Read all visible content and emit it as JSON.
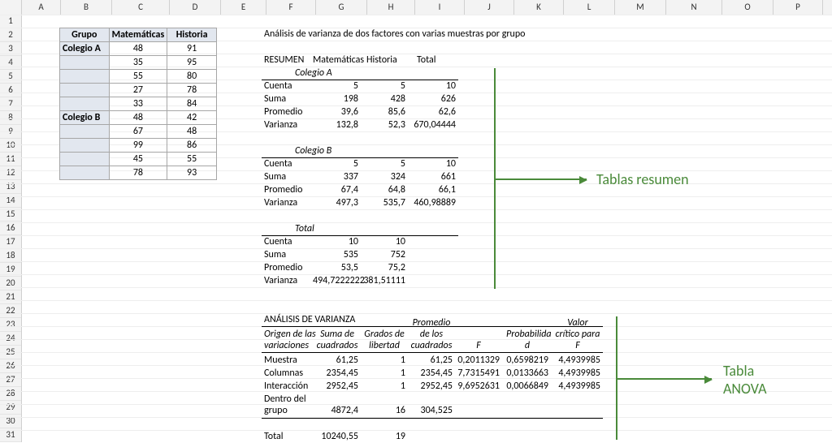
{
  "columns": [
    "A",
    "B",
    "C",
    "D",
    "E",
    "F",
    "G",
    "H",
    "I",
    "J",
    "K",
    "L",
    "M",
    "N",
    "O",
    "P"
  ],
  "rows_visible": 31,
  "input_table": {
    "headers": [
      "Grupo",
      "Matemáticas",
      "Historia"
    ],
    "rows": [
      {
        "label": "Colegio A",
        "c": "48",
        "d": "91"
      },
      {
        "label": "",
        "c": "35",
        "d": "95"
      },
      {
        "label": "",
        "c": "55",
        "d": "80"
      },
      {
        "label": "",
        "c": "27",
        "d": "78"
      },
      {
        "label": "",
        "c": "33",
        "d": "84"
      },
      {
        "label": "Colegio B",
        "c": "48",
        "d": "42"
      },
      {
        "label": "",
        "c": "67",
        "d": "48"
      },
      {
        "label": "",
        "c": "99",
        "d": "86"
      },
      {
        "label": "",
        "c": "45",
        "d": "55"
      },
      {
        "label": "",
        "c": "78",
        "d": "93"
      }
    ]
  },
  "title": "Análisis de varianza de dos factores con varias muestras por grupo",
  "summary": {
    "header": {
      "f": "RESUMEN",
      "g": "Matemáticas",
      "h": "Historia",
      "i": "Total"
    },
    "groups": [
      {
        "name": "Colegio A",
        "rows": [
          {
            "f": "Cuenta",
            "g": "5",
            "h": "5",
            "i": "10"
          },
          {
            "f": "Suma",
            "g": "198",
            "h": "428",
            "i": "626"
          },
          {
            "f": "Promedio",
            "g": "39,6",
            "h": "85,6",
            "i": "62,6"
          },
          {
            "f": "Varianza",
            "g": "132,8",
            "h": "52,3",
            "i": "670,04444"
          }
        ]
      },
      {
        "name": "Colegio B",
        "rows": [
          {
            "f": "Cuenta",
            "g": "5",
            "h": "5",
            "i": "10"
          },
          {
            "f": "Suma",
            "g": "337",
            "h": "324",
            "i": "661"
          },
          {
            "f": "Promedio",
            "g": "67,4",
            "h": "64,8",
            "i": "66,1"
          },
          {
            "f": "Varianza",
            "g": "497,3",
            "h": "535,7",
            "i": "460,98889"
          }
        ]
      },
      {
        "name": "Total",
        "rows": [
          {
            "f": "Cuenta",
            "g": "10",
            "h": "10",
            "i": ""
          },
          {
            "f": "Suma",
            "g": "535",
            "h": "752",
            "i": ""
          },
          {
            "f": "Promedio",
            "g": "53,5",
            "h": "75,2",
            "i": ""
          },
          {
            "f": "Varianza",
            "g": "494,7222222",
            "h": "381,51111",
            "i": ""
          }
        ]
      }
    ]
  },
  "anova": {
    "title": "ANÁLISIS DE VARIANZA",
    "col_headers": [
      {
        "l1": "Origen de las",
        "l2": "variaciones"
      },
      {
        "l1": "Suma de",
        "l2": "cuadrados"
      },
      {
        "l1": "Grados de",
        "l2": "libertad"
      },
      {
        "l1": "Promedio",
        "l2": "de los",
        "l3": "cuadrados"
      },
      {
        "l1": "",
        "l2": "F"
      },
      {
        "l1": "Probabilida",
        "l2": "d"
      },
      {
        "l1": "Valor",
        "l2": "crítico para",
        "l3": "F"
      }
    ],
    "rows": [
      {
        "f": "Muestra",
        "g": "61,25",
        "h": "1",
        "i": "61,25",
        "j": "0,2011329",
        "k": "0,6598219",
        "l": "4,4939985"
      },
      {
        "f": "Columnas",
        "g": "2354,45",
        "h": "1",
        "i": "2354,45",
        "j": "7,7315491",
        "k": "0,0133663",
        "l": "4,4939985"
      },
      {
        "f": "Interacción",
        "g": "2952,45",
        "h": "1",
        "i": "2952,45",
        "j": "9,6952631",
        "k": "0,0066849",
        "l": "4,4939985"
      }
    ],
    "within": {
      "f1": "Dentro del",
      "f2": "grupo",
      "g": "4872,4",
      "h": "16",
      "i": "304,525"
    },
    "total": {
      "f": "Total",
      "g": "10240,55",
      "h": "19"
    }
  },
  "annotations": {
    "summary": "Tablas resumen",
    "anova": "Tabla ANOVA"
  }
}
